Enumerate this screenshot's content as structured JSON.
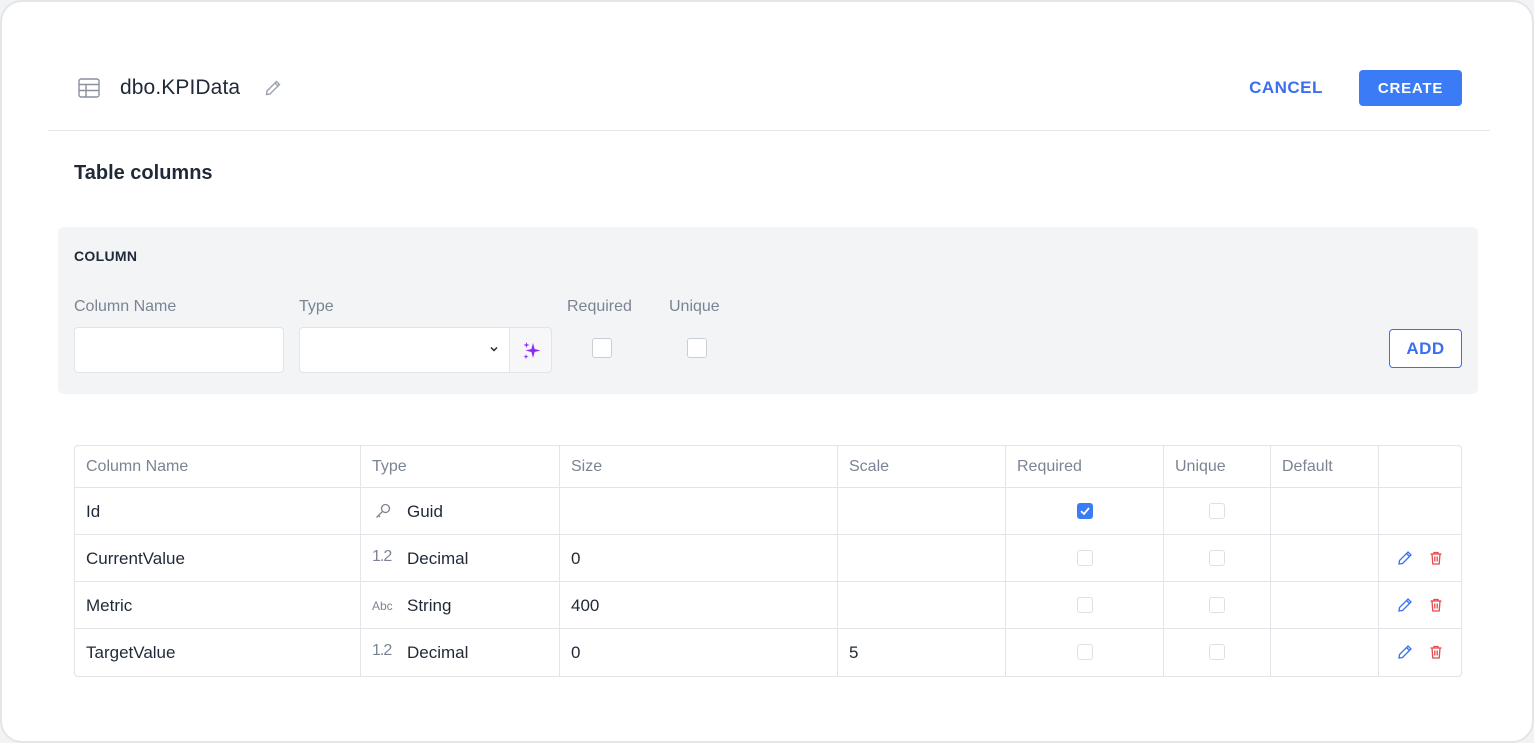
{
  "header": {
    "table_name": "dbo.KPIData",
    "cancel_label": "CANCEL",
    "create_label": "CREATE"
  },
  "section_title": "Table columns",
  "column_form": {
    "heading": "COLUMN",
    "name_label": "Column Name",
    "name_value": "",
    "type_label": "Type",
    "type_value": "",
    "required_label": "Required",
    "required_checked": false,
    "unique_label": "Unique",
    "unique_checked": false,
    "add_label": "ADD"
  },
  "columns_table": {
    "headers": [
      "Column Name",
      "Type",
      "Size",
      "Scale",
      "Required",
      "Unique",
      "Default"
    ],
    "rows": [
      {
        "name": "Id",
        "type_icon": "key-icon",
        "type": "Guid",
        "size": "",
        "scale": "",
        "required": true,
        "unique": false,
        "default": "",
        "actions": false
      },
      {
        "name": "CurrentValue",
        "type_icon": "decimal-icon",
        "type_icon_text": "1.2",
        "type": "Decimal",
        "size": "0",
        "scale": "",
        "required": false,
        "unique": false,
        "default": "",
        "actions": true
      },
      {
        "name": "Metric",
        "type_icon": "string-icon",
        "type_icon_text": "Abc",
        "type": "String",
        "size": "400",
        "scale": "",
        "required": false,
        "unique": false,
        "default": "",
        "actions": true
      },
      {
        "name": "TargetValue",
        "type_icon": "decimal-icon",
        "type_icon_text": "1.2",
        "type": "Decimal",
        "size": "0",
        "scale": "5",
        "required": false,
        "unique": false,
        "default": "",
        "actions": true
      }
    ]
  },
  "colors": {
    "accent": "#3b7cf6",
    "link": "#3b6ff0",
    "delete": "#e5484d",
    "magic": "#8b2cf5"
  }
}
